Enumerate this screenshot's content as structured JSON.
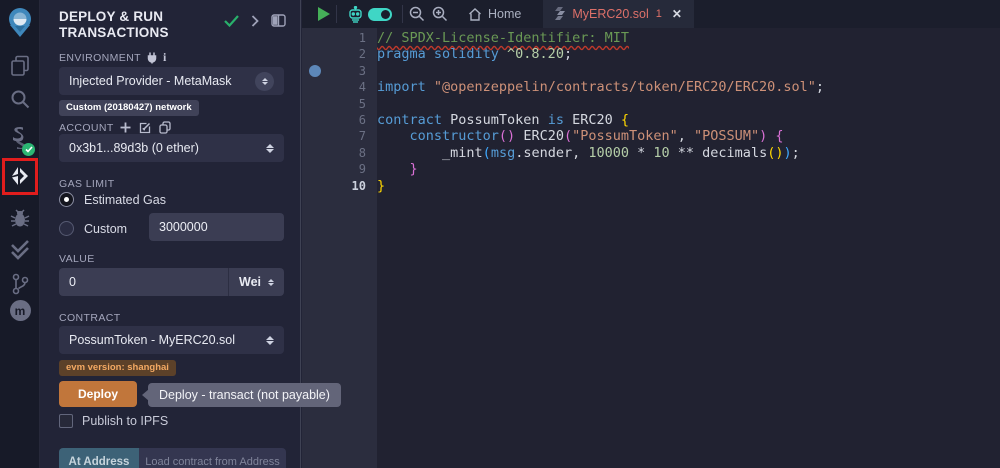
{
  "panel": {
    "title": "DEPLOY & RUN\nTRANSACTIONS",
    "environment": {
      "label": "ENVIRONMENT",
      "value": "Injected Provider - MetaMask",
      "network_badge": "Custom (20180427) network"
    },
    "account": {
      "label": "ACCOUNT",
      "value": "0x3b1...89d3b (0 ether)"
    },
    "gas": {
      "label": "GAS LIMIT",
      "estimated_label": "Estimated Gas",
      "custom_label": "Custom",
      "custom_value": "3000000"
    },
    "value": {
      "label": "VALUE",
      "amount": "0",
      "unit": "Wei"
    },
    "contract": {
      "label": "CONTRACT",
      "value": "PossumToken - MyERC20.sol",
      "evm_badge": "evm version: shanghai"
    },
    "deploy_button": "Deploy",
    "deploy_tooltip": "Deploy - transact (not payable)",
    "publish_label": "Publish to IPFS",
    "at_address": {
      "button": "At Address",
      "placeholder": "Load contract from Address"
    }
  },
  "editor": {
    "home_tab": "Home",
    "file_tab": "MyERC20.sol",
    "tab_badge": "1",
    "close_label": "✕",
    "active_line": 10,
    "breakpoint_line": 3,
    "code": [
      {
        "n": 1,
        "s": [
          {
            "t": "// SPDX-License-Identifier: MIT",
            "c": "com sq"
          }
        ]
      },
      {
        "n": 2,
        "s": [
          {
            "t": "pragma solidity ",
            "c": "kw"
          },
          {
            "t": "^0.8.20",
            "c": "num"
          },
          {
            "t": ";",
            "c": "pl"
          }
        ]
      },
      {
        "n": 3,
        "s": []
      },
      {
        "n": 4,
        "s": [
          {
            "t": "import ",
            "c": "kw"
          },
          {
            "t": "\"@openzeppelin/contracts/token/ERC20/ERC20.sol\"",
            "c": "str"
          },
          {
            "t": ";",
            "c": "pl"
          }
        ]
      },
      {
        "n": 5,
        "s": []
      },
      {
        "n": 6,
        "s": [
          {
            "t": "contract ",
            "c": "kw"
          },
          {
            "t": "PossumToken ",
            "c": "pl"
          },
          {
            "t": "is ",
            "c": "kw"
          },
          {
            "t": "ERC20 ",
            "c": "pl"
          },
          {
            "t": "{",
            "c": "b1"
          }
        ]
      },
      {
        "n": 7,
        "s": [
          {
            "t": "    ",
            "c": "pl"
          },
          {
            "t": "constructor",
            "c": "kw"
          },
          {
            "t": "()",
            "c": "b2"
          },
          {
            "t": " ERC20",
            "c": "pl"
          },
          {
            "t": "(",
            "c": "b2"
          },
          {
            "t": "\"PossumToken\"",
            "c": "str"
          },
          {
            "t": ", ",
            "c": "pl"
          },
          {
            "t": "\"POSSUM\"",
            "c": "str"
          },
          {
            "t": ")",
            "c": "b2"
          },
          {
            "t": " ",
            "c": "pl"
          },
          {
            "t": "{",
            "c": "b2"
          }
        ]
      },
      {
        "n": 8,
        "s": [
          {
            "t": "        _mint",
            "c": "pl"
          },
          {
            "t": "(",
            "c": "b3"
          },
          {
            "t": "msg",
            "c": "kw"
          },
          {
            "t": ".sender, ",
            "c": "pl"
          },
          {
            "t": "10000",
            "c": "num"
          },
          {
            "t": " * ",
            "c": "pl"
          },
          {
            "t": "10",
            "c": "num"
          },
          {
            "t": " ** ",
            "c": "pl"
          },
          {
            "t": "decimals",
            "c": "pl"
          },
          {
            "t": "()",
            "c": "b1"
          },
          {
            "t": ")",
            "c": "b3"
          },
          {
            "t": ";",
            "c": "pl"
          }
        ]
      },
      {
        "n": 9,
        "s": [
          {
            "t": "    ",
            "c": "pl"
          },
          {
            "t": "}",
            "c": "b2"
          }
        ]
      },
      {
        "n": 10,
        "s": [
          {
            "t": "}",
            "c": "b1"
          }
        ]
      }
    ]
  },
  "icons": {
    "activity_bar": [
      "remix-logo",
      "file-explorer-icon",
      "search-icon",
      "solidity-compiler-icon",
      "deploy-run-icon",
      "debugger-bug-icon",
      "unit-test-check-icon",
      "git-branch-icon",
      "plugin-manager-icon"
    ],
    "toolbar": [
      "play-icon",
      "ai-robot-icon",
      "copilot-toggle",
      "zoom-out-icon",
      "zoom-in-icon",
      "home-icon",
      "solidity-file-icon",
      "close-icon"
    ],
    "panel": [
      "compile-check-icon",
      "chevron-right-icon",
      "split-view-icon",
      "plug-icon",
      "info-icon",
      "plus-icon",
      "edit-icon",
      "copy-icon"
    ]
  },
  "colors": {
    "accent_orange": "#c1763b",
    "badge_green": "#2bb673",
    "highlight_red": "#e11d1d",
    "copilot_cyan": "#3fd6c5",
    "play_green": "#45b058",
    "tab_filename": "#dd7069",
    "breakpoint_blue": "#5d87b8"
  }
}
